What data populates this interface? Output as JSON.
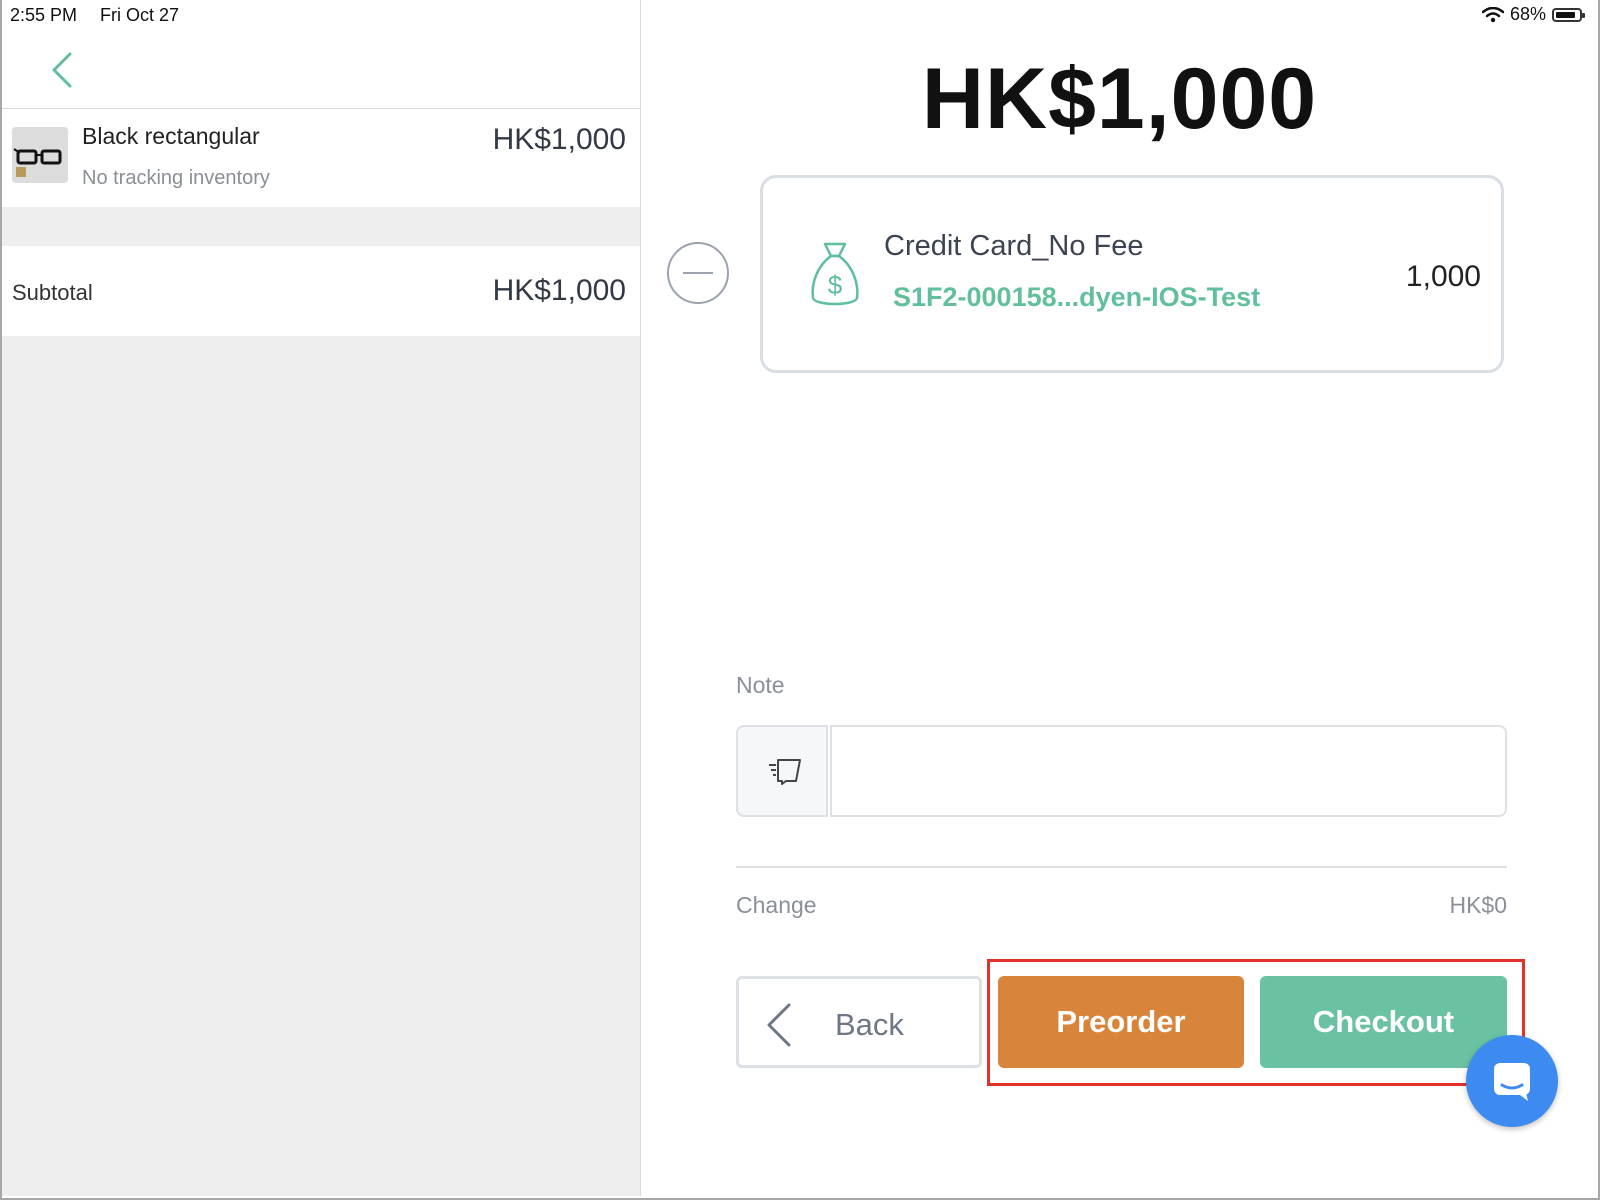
{
  "status_bar": {
    "time": "2:55 PM",
    "date": "Fri Oct 27",
    "battery": "68%"
  },
  "cart": {
    "items": [
      {
        "name": "Black rectangular",
        "subtitle": "No tracking inventory",
        "price": "HK$1,000"
      }
    ],
    "subtotal_label": "Subtotal",
    "subtotal_value": "HK$1,000"
  },
  "payment": {
    "total": "HK$1,000",
    "method_name": "Credit Card_No Fee",
    "method_ref": "S1F2-000158...dyen-IOS-Test",
    "method_amount": "1,000",
    "note_label": "Note",
    "note_value": "",
    "change_label": "Change",
    "change_value": "HK$0"
  },
  "actions": {
    "back_label": "Back",
    "preorder_label": "Preorder",
    "checkout_label": "Checkout"
  },
  "colors": {
    "accent_green": "#6ac2a3",
    "preorder_orange": "#d9843b",
    "chat_blue": "#3d8af0",
    "highlight_red": "#e2332a"
  }
}
